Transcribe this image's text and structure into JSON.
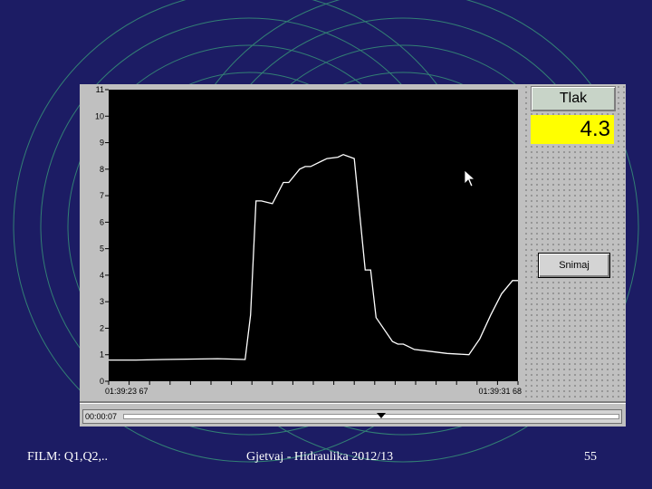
{
  "chart_data": {
    "type": "line",
    "title": "",
    "xlabel": "",
    "ylabel": "",
    "ylim": [
      0,
      11
    ],
    "yticks": [
      "0",
      "1",
      "2",
      "3",
      "4",
      "5",
      "6",
      "7",
      "8",
      "9",
      "10",
      "11"
    ],
    "x_tick_labels": [
      "01:39:23 67",
      "01:39:31 68"
    ],
    "grid": false,
    "background": "#000000",
    "line_color": "#ffffff",
    "series": [
      {
        "x": [
          0,
          5,
          10,
          20,
          25,
          26,
          27,
          28,
          30,
          32,
          33,
          35,
          36,
          37,
          39,
          40,
          42,
          43,
          45,
          47,
          48,
          49,
          52,
          53,
          54,
          55,
          56,
          58,
          62,
          66,
          68,
          70,
          72,
          74,
          75
        ],
        "y": [
          0.8,
          0.8,
          0.82,
          0.85,
          0.82,
          2.5,
          6.8,
          6.8,
          6.7,
          7.5,
          7.5,
          8.0,
          8.1,
          8.1,
          8.3,
          8.4,
          8.45,
          8.55,
          8.4,
          4.2,
          4.2,
          2.4,
          1.5,
          1.4,
          1.4,
          1.3,
          1.2,
          1.15,
          1.05,
          1.0,
          1.6,
          2.5,
          3.3,
          3.8,
          3.8
        ]
      }
    ]
  },
  "side_panel": {
    "tlak_label": "Tlak",
    "value": "4.3",
    "value_color": "#ffff00",
    "snimaj_label": "Snimaj"
  },
  "timebar": {
    "readout": "00:00:07",
    "position": 0.52
  },
  "footer": {
    "left": "FILM: Q1,Q2,..",
    "center": "Gjetvaj - Hidraulika 2012/13",
    "page": "55"
  },
  "cursor": "arrow-cursor-icon"
}
